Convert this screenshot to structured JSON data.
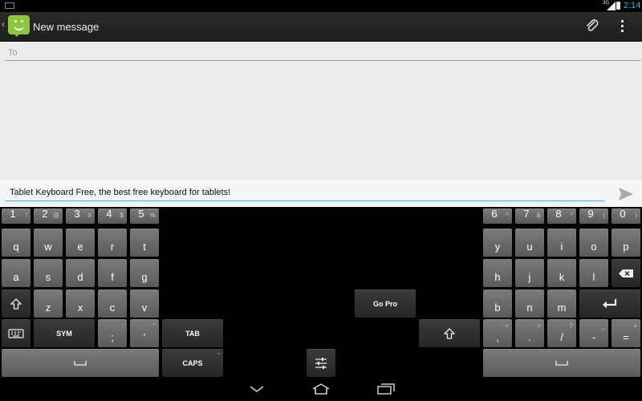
{
  "status": {
    "time": "2:14",
    "signal_label": "3G"
  },
  "actionbar": {
    "title": "New message"
  },
  "compose": {
    "to_placeholder": "To"
  },
  "message": {
    "text": "Tablet Keyboard Free, the best free keyboard for tablets!"
  },
  "keyboard": {
    "left_numbers": [
      {
        "main": "1",
        "alt": "!"
      },
      {
        "main": "2",
        "alt": "@"
      },
      {
        "main": "3",
        "alt": "#"
      },
      {
        "main": "4",
        "alt": "$"
      },
      {
        "main": "5",
        "alt": "%"
      }
    ],
    "right_numbers": [
      {
        "main": "6",
        "alt": "^"
      },
      {
        "main": "7",
        "alt": "&"
      },
      {
        "main": "8",
        "alt": "*"
      },
      {
        "main": "9",
        "alt": "("
      },
      {
        "main": "0",
        "alt": ")"
      }
    ],
    "row_q_left": [
      "q",
      "w",
      "e",
      "r",
      "t"
    ],
    "row_q_right": [
      "y",
      "u",
      "i",
      "o",
      "p"
    ],
    "row_a_left": [
      "a",
      "s",
      "d",
      "f",
      "g"
    ],
    "row_a_right": [
      "h",
      "j",
      "k",
      "l"
    ],
    "row_z_left": [
      "z",
      "x",
      "c",
      "v"
    ],
    "row_z_right": [
      "b",
      "n",
      "m"
    ],
    "sym_label": "SYM",
    "semicolon": {
      "main": ";",
      "alt": ":"
    },
    "quote": {
      "main": "'",
      "alt": "\""
    },
    "tab_label": "TAB",
    "caps_label": "CAPS",
    "go_pro_label": "Go Pro",
    "comma": {
      "main": ",",
      "alt": "<"
    },
    "period": {
      "main": ".",
      "alt": ">"
    },
    "slash": {
      "main": "/",
      "alt": "?"
    },
    "minus": {
      "main": "-",
      "alt": "_"
    },
    "equals": {
      "main": "=",
      "alt": "+"
    },
    "caps_alt": "\""
  },
  "icons": {
    "app": "messaging-smiley-icon",
    "attach": "paperclip-icon",
    "overflow": "overflow-menu-icon",
    "send": "send-icon",
    "backspace": "backspace-icon",
    "enter": "enter-icon",
    "shift": "shift-icon",
    "keyboard": "keyboard-icon",
    "settings": "sliders-icon",
    "nav_back": "chevron-down-icon",
    "nav_home": "home-icon",
    "nav_recents": "recents-icon"
  },
  "colors": {
    "accent": "#33b5e5",
    "app_green": "#8cc63f"
  }
}
